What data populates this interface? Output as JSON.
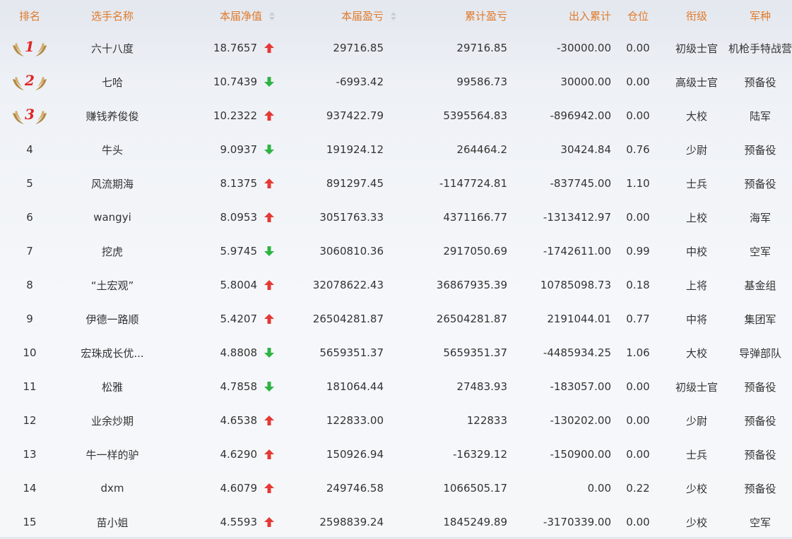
{
  "headers": {
    "rank": "排名",
    "name": "选手名称",
    "nav": "本届净值",
    "profit": "本届盈亏",
    "cumulative": "累计盈亏",
    "inout": "出入累计",
    "position": "仓位",
    "title": "衔级",
    "branch": "军种"
  },
  "colors": {
    "header_text": "#e07a2a",
    "up": "#e53935",
    "down": "#2fb344",
    "medal_wing": "#b58a46",
    "medal_number": "#e02424"
  },
  "rows": [
    {
      "rank": "1",
      "medal": true,
      "name": "六十八度",
      "nav": "18.7657",
      "trend": "up",
      "profit": "29716.85",
      "cumulative": "29716.85",
      "inout": "-30000.00",
      "position": "0.00",
      "title": "初级士官",
      "branch": "机枪手特战营"
    },
    {
      "rank": "2",
      "medal": true,
      "name": "七哈",
      "nav": "10.7439",
      "trend": "down",
      "profit": "-6993.42",
      "cumulative": "99586.73",
      "inout": "30000.00",
      "position": "0.00",
      "title": "高级士官",
      "branch": "预备役"
    },
    {
      "rank": "3",
      "medal": true,
      "name": "赚钱养俊俊",
      "nav": "10.2322",
      "trend": "up",
      "profit": "937422.79",
      "cumulative": "5395564.83",
      "inout": "-896942.00",
      "position": "0.00",
      "title": "大校",
      "branch": "陆军"
    },
    {
      "rank": "4",
      "medal": false,
      "name": "牛头",
      "nav": "9.0937",
      "trend": "down",
      "profit": "191924.12",
      "cumulative": "264464.2",
      "inout": "30424.84",
      "position": "0.76",
      "title": "少尉",
      "branch": "预备役"
    },
    {
      "rank": "5",
      "medal": false,
      "name": "风流期海",
      "nav": "8.1375",
      "trend": "up",
      "profit": "891297.45",
      "cumulative": "-1147724.81",
      "inout": "-837745.00",
      "position": "1.10",
      "title": "士兵",
      "branch": "预备役"
    },
    {
      "rank": "6",
      "medal": false,
      "name": "wangyi",
      "nav": "8.0953",
      "trend": "up",
      "profit": "3051763.33",
      "cumulative": "4371166.77",
      "inout": "-1313412.97",
      "position": "0.00",
      "title": "上校",
      "branch": "海军"
    },
    {
      "rank": "7",
      "medal": false,
      "name": "挖虎",
      "nav": "5.9745",
      "trend": "down",
      "profit": "3060810.36",
      "cumulative": "2917050.69",
      "inout": "-1742611.00",
      "position": "0.99",
      "title": "中校",
      "branch": "空军"
    },
    {
      "rank": "8",
      "medal": false,
      "name": "“土宏观”",
      "nav": "5.8004",
      "trend": "up",
      "profit": "32078622.43",
      "cumulative": "36867935.39",
      "inout": "10785098.73",
      "position": "0.18",
      "title": "上将",
      "branch": "基金组"
    },
    {
      "rank": "9",
      "medal": false,
      "name": "伊德一路顺",
      "nav": "5.4207",
      "trend": "up",
      "profit": "26504281.87",
      "cumulative": "26504281.87",
      "inout": "2191044.01",
      "position": "0.77",
      "title": "中将",
      "branch": "集团军"
    },
    {
      "rank": "10",
      "medal": false,
      "name": "宏珠成长优...",
      "nav": "4.8808",
      "trend": "down",
      "profit": "5659351.37",
      "cumulative": "5659351.37",
      "inout": "-4485934.25",
      "position": "1.06",
      "title": "大校",
      "branch": "导弹部队"
    },
    {
      "rank": "11",
      "medal": false,
      "name": "松雅",
      "nav": "4.7858",
      "trend": "down",
      "profit": "181064.44",
      "cumulative": "27483.93",
      "inout": "-183057.00",
      "position": "0.00",
      "title": "初级士官",
      "branch": "预备役"
    },
    {
      "rank": "12",
      "medal": false,
      "name": "业余炒期",
      "nav": "4.6538",
      "trend": "up",
      "profit": "122833.00",
      "cumulative": "122833",
      "inout": "-130202.00",
      "position": "0.00",
      "title": "少尉",
      "branch": "预备役"
    },
    {
      "rank": "13",
      "medal": false,
      "name": "牛一样的驴",
      "nav": "4.6290",
      "trend": "up",
      "profit": "150926.94",
      "cumulative": "-16329.12",
      "inout": "-150900.00",
      "position": "0.00",
      "title": "士兵",
      "branch": "预备役"
    },
    {
      "rank": "14",
      "medal": false,
      "name": "dxm",
      "nav": "4.6079",
      "trend": "up",
      "profit": "249746.58",
      "cumulative": "1066505.17",
      "inout": "0.00",
      "position": "0.22",
      "title": "少校",
      "branch": "预备役"
    },
    {
      "rank": "15",
      "medal": false,
      "name": "苗小姐",
      "nav": "4.5593",
      "trend": "up",
      "profit": "2598839.24",
      "cumulative": "1845249.89",
      "inout": "-3170339.00",
      "position": "0.00",
      "title": "少校",
      "branch": "空军"
    }
  ]
}
